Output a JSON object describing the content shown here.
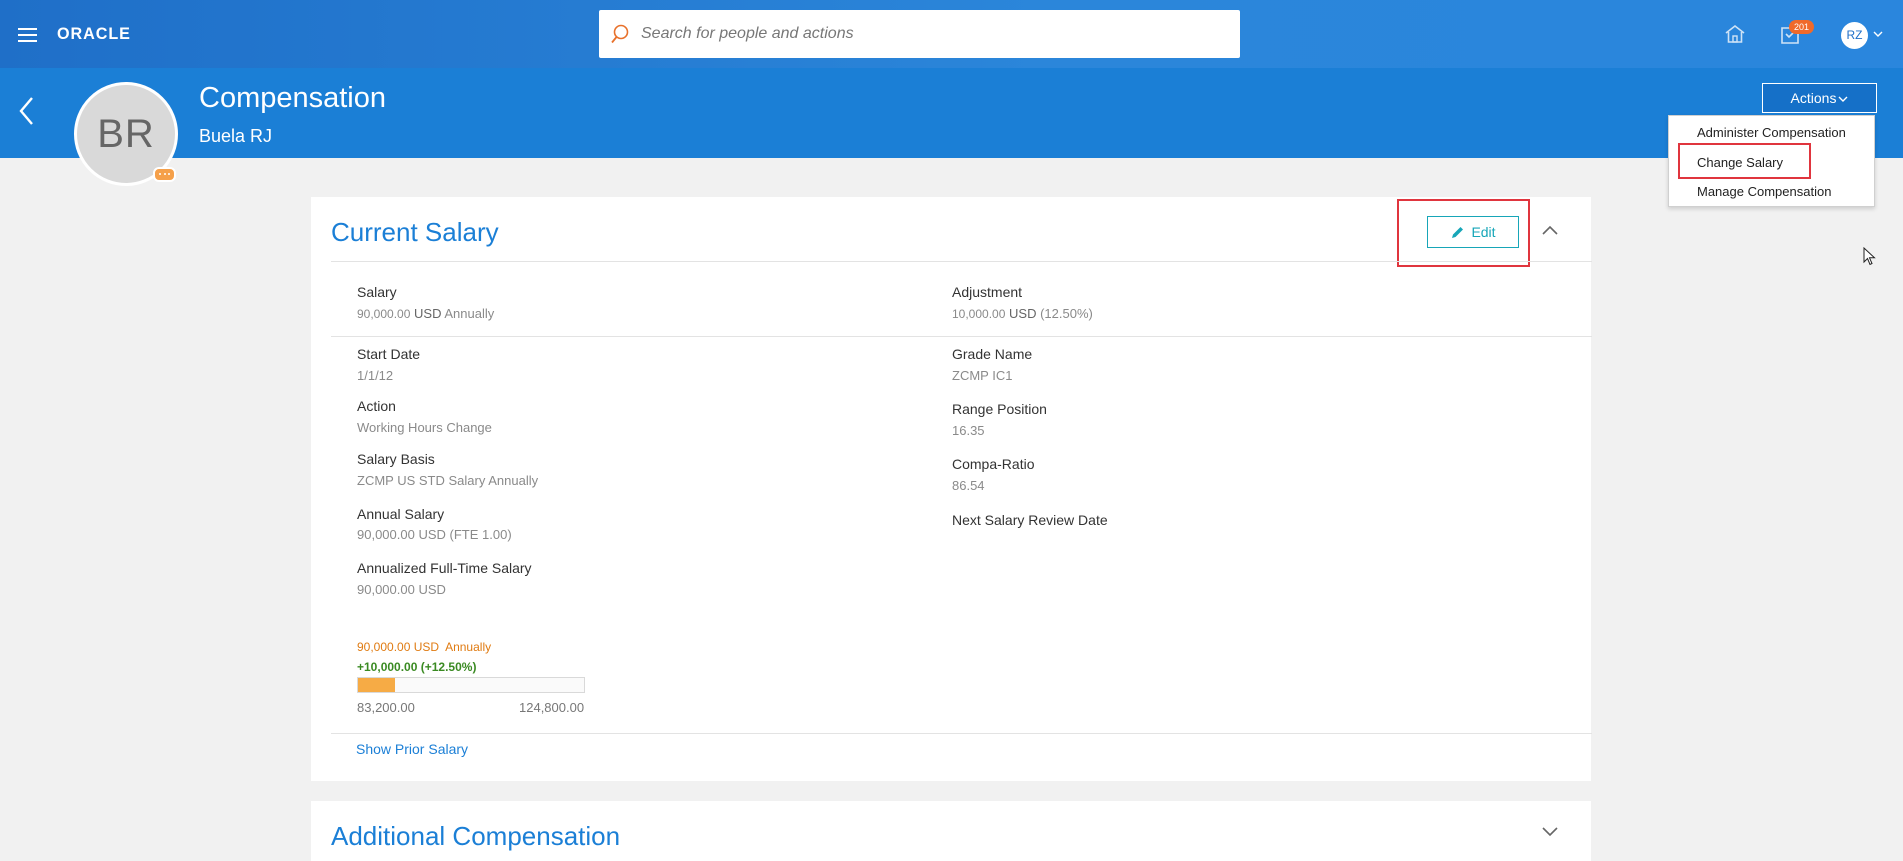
{
  "brand": {
    "logo": "ORACLE"
  },
  "search": {
    "placeholder": "Search for people and actions"
  },
  "notifications": {
    "count": "201"
  },
  "user": {
    "initials": "RZ"
  },
  "header": {
    "title": "Compensation",
    "person_name": "Buela RJ",
    "person_initials": "BR",
    "actions_label": "Actions"
  },
  "actions_menu": {
    "items": [
      "Administer Compensation",
      "Change Salary",
      "Manage Compensation"
    ],
    "highlighted": "Change Salary"
  },
  "current_salary": {
    "title": "Current Salary",
    "edit_label": "Edit",
    "salary": {
      "label": "Salary",
      "amount": "90,000.00",
      "currency": "USD",
      "frequency": "Annually"
    },
    "adjustment": {
      "label": "Adjustment",
      "amount": "10,000.00",
      "currency": "USD",
      "percent": "(12.50%)"
    },
    "left_fields": [
      {
        "label": "Start Date",
        "value": "1/1/12"
      },
      {
        "label": "Action",
        "value": "Working Hours Change"
      },
      {
        "label": "Salary Basis",
        "value": "ZCMP US STD Salary Annually"
      },
      {
        "label": "Annual Salary",
        "amount": "90,000.00",
        "suffix": "USD (FTE 1.00)"
      },
      {
        "label": "Annualized Full-Time Salary",
        "amount": "90,000.00",
        "suffix": "USD"
      }
    ],
    "right_fields": [
      {
        "label": "Grade Name",
        "value": "ZCMP IC1"
      },
      {
        "label": "Range Position",
        "value": "16.35"
      },
      {
        "label": "Compa-Ratio",
        "value": "86.54"
      },
      {
        "label": "Next Salary Review Date",
        "value": ""
      }
    ],
    "range_chart": {
      "current_amount": "90,000.00",
      "current_suffix": "USD  Annually",
      "adjustment_text": "+10,000.00",
      "adjustment_percent": "(+12.50%)",
      "min": "83,200.00",
      "max": "124,800.00",
      "position_fraction": 0.1635
    },
    "show_prior_label": "Show Prior Salary"
  },
  "additional_compensation": {
    "title": "Additional Compensation"
  },
  "colors": {
    "brand_blue": "#1b7fd6",
    "accent_teal": "#17a6b8",
    "highlight_red": "#e0353e",
    "range_fill": "#f6ab45"
  }
}
